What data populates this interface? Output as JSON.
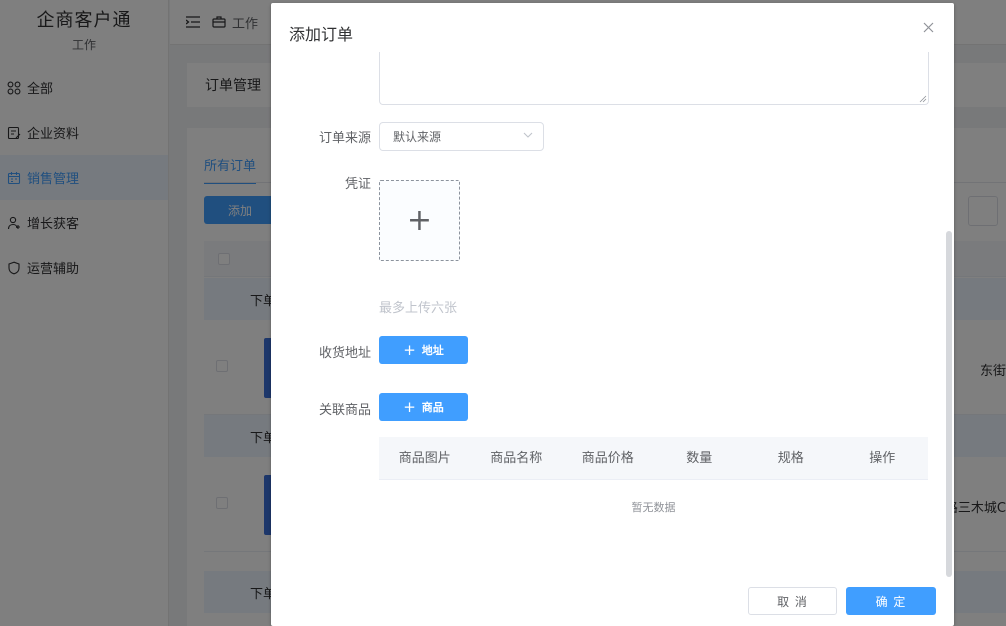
{
  "app": {
    "title": "企商客户通",
    "subtitle": "工作"
  },
  "sidebar": {
    "items": [
      {
        "label": "全部",
        "icon": "apps-icon"
      },
      {
        "label": "企业资料",
        "icon": "document-edit-icon"
      },
      {
        "label": "销售管理",
        "icon": "calendar-icon"
      },
      {
        "label": "增长获客",
        "icon": "user-add-icon"
      },
      {
        "label": "运营辅助",
        "icon": "shield-icon"
      }
    ]
  },
  "topbar": {
    "crumb": "工作"
  },
  "page": {
    "heading": "订单管理",
    "tab_active": "所有订单",
    "add_button": "添加",
    "group_label": "下单",
    "row1_addr": "东街",
    "row2_addr": "路三木城C"
  },
  "dialog": {
    "title": "添加订单",
    "fields": {
      "source_label": "订单来源",
      "source_value": "默认来源",
      "voucher_label": "凭证",
      "upload_tip": "最多上传六张",
      "address_label": "收货地址",
      "address_button": "地址",
      "goods_label": "关联商品",
      "goods_button": "商品"
    },
    "goods_table": {
      "columns": [
        "商品图片",
        "商品名称",
        "商品价格",
        "数量",
        "规格",
        "操作"
      ],
      "empty_text": "暂无数据"
    },
    "cancel": "取 消",
    "confirm": "确 定"
  },
  "colors": {
    "primary": "#409eff",
    "mask": "rgba(0,0,0,0.5)"
  }
}
